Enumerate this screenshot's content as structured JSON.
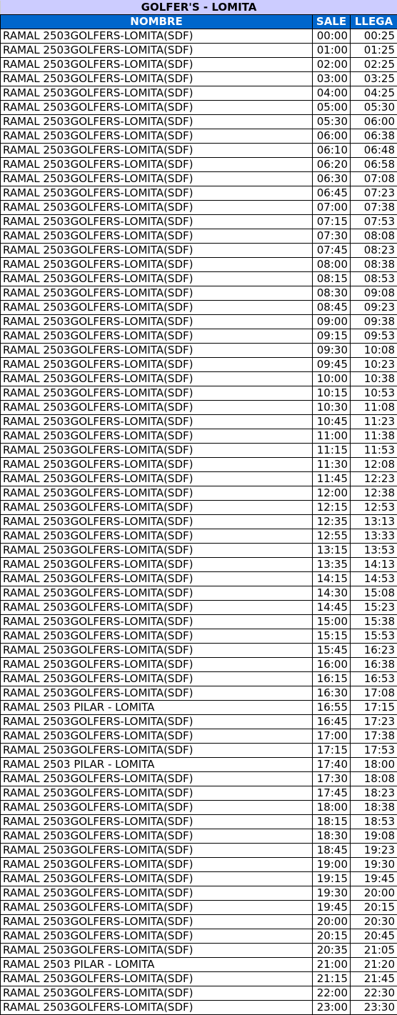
{
  "title": "GOLFER'S - LOMITA",
  "colors": {
    "title_bg": "#ccccff",
    "header_bg": "#0066cc"
  },
  "headers": {
    "name": "NOMBRE",
    "depart": "SALE",
    "arrive": "LLEGA"
  },
  "rows": [
    [
      "RAMAL 2503GOLFERS-LOMITA(SDF)",
      "00:00",
      "00:25"
    ],
    [
      "RAMAL 2503GOLFERS-LOMITA(SDF)",
      "01:00",
      "01:25"
    ],
    [
      "RAMAL 2503GOLFERS-LOMITA(SDF)",
      "02:00",
      "02:25"
    ],
    [
      "RAMAL 2503GOLFERS-LOMITA(SDF)",
      "03:00",
      "03:25"
    ],
    [
      "RAMAL 2503GOLFERS-LOMITA(SDF)",
      "04:00",
      "04:25"
    ],
    [
      "RAMAL 2503GOLFERS-LOMITA(SDF)",
      "05:00",
      "05:30"
    ],
    [
      "RAMAL 2503GOLFERS-LOMITA(SDF)",
      "05:30",
      "06:00"
    ],
    [
      "RAMAL 2503GOLFERS-LOMITA(SDF)",
      "06:00",
      "06:38"
    ],
    [
      "RAMAL 2503GOLFERS-LOMITA(SDF)",
      "06:10",
      "06:48"
    ],
    [
      "RAMAL 2503GOLFERS-LOMITA(SDF)",
      "06:20",
      "06:58"
    ],
    [
      "RAMAL 2503GOLFERS-LOMITA(SDF)",
      "06:30",
      "07:08"
    ],
    [
      "RAMAL 2503GOLFERS-LOMITA(SDF)",
      "06:45",
      "07:23"
    ],
    [
      "RAMAL 2503GOLFERS-LOMITA(SDF)",
      "07:00",
      "07:38"
    ],
    [
      "RAMAL 2503GOLFERS-LOMITA(SDF)",
      "07:15",
      "07:53"
    ],
    [
      "RAMAL 2503GOLFERS-LOMITA(SDF)",
      "07:30",
      "08:08"
    ],
    [
      "RAMAL 2503GOLFERS-LOMITA(SDF)",
      "07:45",
      "08:23"
    ],
    [
      "RAMAL 2503GOLFERS-LOMITA(SDF)",
      "08:00",
      "08:38"
    ],
    [
      "RAMAL 2503GOLFERS-LOMITA(SDF)",
      "08:15",
      "08:53"
    ],
    [
      "RAMAL 2503GOLFERS-LOMITA(SDF)",
      "08:30",
      "09:08"
    ],
    [
      "RAMAL 2503GOLFERS-LOMITA(SDF)",
      "08:45",
      "09:23"
    ],
    [
      "RAMAL 2503GOLFERS-LOMITA(SDF)",
      "09:00",
      "09:38"
    ],
    [
      "RAMAL 2503GOLFERS-LOMITA(SDF)",
      "09:15",
      "09:53"
    ],
    [
      "RAMAL 2503GOLFERS-LOMITA(SDF)",
      "09:30",
      "10:08"
    ],
    [
      "RAMAL 2503GOLFERS-LOMITA(SDF)",
      "09:45",
      "10:23"
    ],
    [
      "RAMAL 2503GOLFERS-LOMITA(SDF)",
      "10:00",
      "10:38"
    ],
    [
      "RAMAL 2503GOLFERS-LOMITA(SDF)",
      "10:15",
      "10:53"
    ],
    [
      "RAMAL 2503GOLFERS-LOMITA(SDF)",
      "10:30",
      "11:08"
    ],
    [
      "RAMAL 2503GOLFERS-LOMITA(SDF)",
      "10:45",
      "11:23"
    ],
    [
      "RAMAL 2503GOLFERS-LOMITA(SDF)",
      "11:00",
      "11:38"
    ],
    [
      "RAMAL 2503GOLFERS-LOMITA(SDF)",
      "11:15",
      "11:53"
    ],
    [
      "RAMAL 2503GOLFERS-LOMITA(SDF)",
      "11:30",
      "12:08"
    ],
    [
      "RAMAL 2503GOLFERS-LOMITA(SDF)",
      "11:45",
      "12:23"
    ],
    [
      "RAMAL 2503GOLFERS-LOMITA(SDF)",
      "12:00",
      "12:38"
    ],
    [
      "RAMAL 2503GOLFERS-LOMITA(SDF)",
      "12:15",
      "12:53"
    ],
    [
      "RAMAL 2503GOLFERS-LOMITA(SDF)",
      "12:35",
      "13:13"
    ],
    [
      "RAMAL 2503GOLFERS-LOMITA(SDF)",
      "12:55",
      "13:33"
    ],
    [
      "RAMAL 2503GOLFERS-LOMITA(SDF)",
      "13:15",
      "13:53"
    ],
    [
      "RAMAL 2503GOLFERS-LOMITA(SDF)",
      "13:35",
      "14:13"
    ],
    [
      "RAMAL 2503GOLFERS-LOMITA(SDF)",
      "14:15",
      "14:53"
    ],
    [
      "RAMAL 2503GOLFERS-LOMITA(SDF)",
      "14:30",
      "15:08"
    ],
    [
      "RAMAL 2503GOLFERS-LOMITA(SDF)",
      "14:45",
      "15:23"
    ],
    [
      "RAMAL 2503GOLFERS-LOMITA(SDF)",
      "15:00",
      "15:38"
    ],
    [
      "RAMAL 2503GOLFERS-LOMITA(SDF)",
      "15:15",
      "15:53"
    ],
    [
      "RAMAL 2503GOLFERS-LOMITA(SDF)",
      "15:45",
      "16:23"
    ],
    [
      "RAMAL 2503GOLFERS-LOMITA(SDF)",
      "16:00",
      "16:38"
    ],
    [
      "RAMAL 2503GOLFERS-LOMITA(SDF)",
      "16:15",
      "16:53"
    ],
    [
      "RAMAL 2503GOLFERS-LOMITA(SDF)",
      "16:30",
      "17:08"
    ],
    [
      "RAMAL 2503 PILAR - LOMITA",
      "16:55",
      "17:15"
    ],
    [
      "RAMAL 2503GOLFERS-LOMITA(SDF)",
      "16:45",
      "17:23"
    ],
    [
      "RAMAL 2503GOLFERS-LOMITA(SDF)",
      "17:00",
      "17:38"
    ],
    [
      "RAMAL 2503GOLFERS-LOMITA(SDF)",
      "17:15",
      "17:53"
    ],
    [
      "RAMAL 2503 PILAR - LOMITA",
      "17:40",
      "18:00"
    ],
    [
      "RAMAL 2503GOLFERS-LOMITA(SDF)",
      "17:30",
      "18:08"
    ],
    [
      "RAMAL 2503GOLFERS-LOMITA(SDF)",
      "17:45",
      "18:23"
    ],
    [
      "RAMAL 2503GOLFERS-LOMITA(SDF)",
      "18:00",
      "18:38"
    ],
    [
      "RAMAL 2503GOLFERS-LOMITA(SDF)",
      "18:15",
      "18:53"
    ],
    [
      "RAMAL 2503GOLFERS-LOMITA(SDF)",
      "18:30",
      "19:08"
    ],
    [
      "RAMAL 2503GOLFERS-LOMITA(SDF)",
      "18:45",
      "19:23"
    ],
    [
      "RAMAL 2503GOLFERS-LOMITA(SDF)",
      "19:00",
      "19:30"
    ],
    [
      "RAMAL 2503GOLFERS-LOMITA(SDF)",
      "19:15",
      "19:45"
    ],
    [
      "RAMAL 2503GOLFERS-LOMITA(SDF)",
      "19:30",
      "20:00"
    ],
    [
      "RAMAL 2503GOLFERS-LOMITA(SDF)",
      "19:45",
      "20:15"
    ],
    [
      "RAMAL 2503GOLFERS-LOMITA(SDF)",
      "20:00",
      "20:30"
    ],
    [
      "RAMAL 2503GOLFERS-LOMITA(SDF)",
      "20:15",
      "20:45"
    ],
    [
      "RAMAL 2503GOLFERS-LOMITA(SDF)",
      "20:35",
      "21:05"
    ],
    [
      "RAMAL 2503 PILAR - LOMITA",
      "21:00",
      "21:20"
    ],
    [
      "RAMAL 2503GOLFERS-LOMITA(SDF)",
      "21:15",
      "21:45"
    ],
    [
      "RAMAL 2503GOLFERS-LOMITA(SDF)",
      "22:00",
      "22:30"
    ],
    [
      "RAMAL 2503GOLFERS-LOMITA(SDF)",
      "23:00",
      "23:30"
    ]
  ]
}
